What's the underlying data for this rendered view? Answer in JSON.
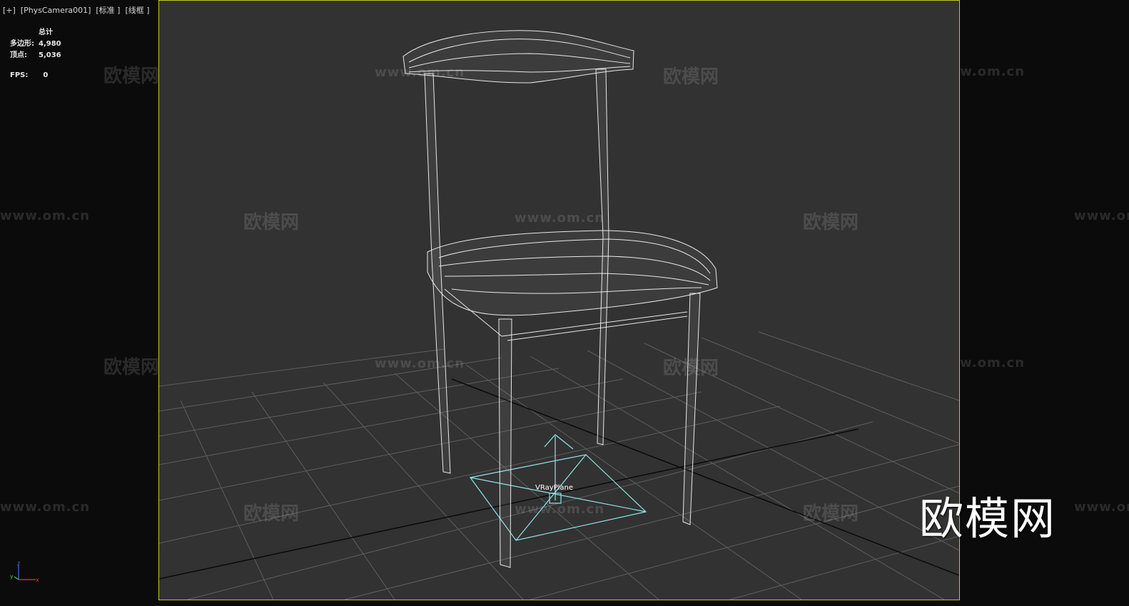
{
  "viewport_label": "[+]  [PhysCamera001]  [标准 ]  [线框 ]",
  "stats": {
    "header": "总计",
    "rows": [
      {
        "label": "多边形:",
        "value": "4,980"
      },
      {
        "label": "顶点:",
        "value": "5,036"
      }
    ],
    "fps_label": "FPS:",
    "fps_value": "0"
  },
  "object_label": "VRayPlane",
  "watermark_brand": "欧模网",
  "watermark_url": "www.om.cn",
  "logo_text": "欧模网",
  "gizmo_axes": {
    "z": "z",
    "x": "x",
    "y": "y"
  },
  "colors": {
    "viewport_bg": "#323232",
    "viewport_border": "#c8c428",
    "wireframe": "#e8e8e8",
    "helper": "#8fe3e8",
    "grid": "#5a5a5a"
  }
}
